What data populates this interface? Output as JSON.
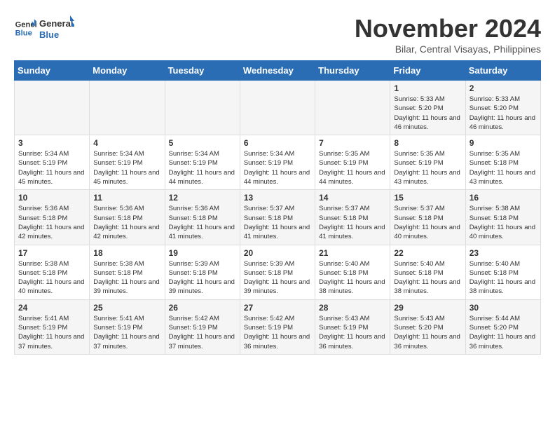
{
  "logo": {
    "line1": "General",
    "line2": "Blue"
  },
  "title": "November 2024",
  "subtitle": "Bilar, Central Visayas, Philippines",
  "weekdays": [
    "Sunday",
    "Monday",
    "Tuesday",
    "Wednesday",
    "Thursday",
    "Friday",
    "Saturday"
  ],
  "weeks": [
    [
      {
        "day": "",
        "info": ""
      },
      {
        "day": "",
        "info": ""
      },
      {
        "day": "",
        "info": ""
      },
      {
        "day": "",
        "info": ""
      },
      {
        "day": "",
        "info": ""
      },
      {
        "day": "1",
        "info": "Sunrise: 5:33 AM\nSunset: 5:20 PM\nDaylight: 11 hours and 46 minutes."
      },
      {
        "day": "2",
        "info": "Sunrise: 5:33 AM\nSunset: 5:20 PM\nDaylight: 11 hours and 46 minutes."
      }
    ],
    [
      {
        "day": "3",
        "info": "Sunrise: 5:34 AM\nSunset: 5:19 PM\nDaylight: 11 hours and 45 minutes."
      },
      {
        "day": "4",
        "info": "Sunrise: 5:34 AM\nSunset: 5:19 PM\nDaylight: 11 hours and 45 minutes."
      },
      {
        "day": "5",
        "info": "Sunrise: 5:34 AM\nSunset: 5:19 PM\nDaylight: 11 hours and 44 minutes."
      },
      {
        "day": "6",
        "info": "Sunrise: 5:34 AM\nSunset: 5:19 PM\nDaylight: 11 hours and 44 minutes."
      },
      {
        "day": "7",
        "info": "Sunrise: 5:35 AM\nSunset: 5:19 PM\nDaylight: 11 hours and 44 minutes."
      },
      {
        "day": "8",
        "info": "Sunrise: 5:35 AM\nSunset: 5:19 PM\nDaylight: 11 hours and 43 minutes."
      },
      {
        "day": "9",
        "info": "Sunrise: 5:35 AM\nSunset: 5:18 PM\nDaylight: 11 hours and 43 minutes."
      }
    ],
    [
      {
        "day": "10",
        "info": "Sunrise: 5:36 AM\nSunset: 5:18 PM\nDaylight: 11 hours and 42 minutes."
      },
      {
        "day": "11",
        "info": "Sunrise: 5:36 AM\nSunset: 5:18 PM\nDaylight: 11 hours and 42 minutes."
      },
      {
        "day": "12",
        "info": "Sunrise: 5:36 AM\nSunset: 5:18 PM\nDaylight: 11 hours and 41 minutes."
      },
      {
        "day": "13",
        "info": "Sunrise: 5:37 AM\nSunset: 5:18 PM\nDaylight: 11 hours and 41 minutes."
      },
      {
        "day": "14",
        "info": "Sunrise: 5:37 AM\nSunset: 5:18 PM\nDaylight: 11 hours and 41 minutes."
      },
      {
        "day": "15",
        "info": "Sunrise: 5:37 AM\nSunset: 5:18 PM\nDaylight: 11 hours and 40 minutes."
      },
      {
        "day": "16",
        "info": "Sunrise: 5:38 AM\nSunset: 5:18 PM\nDaylight: 11 hours and 40 minutes."
      }
    ],
    [
      {
        "day": "17",
        "info": "Sunrise: 5:38 AM\nSunset: 5:18 PM\nDaylight: 11 hours and 40 minutes."
      },
      {
        "day": "18",
        "info": "Sunrise: 5:38 AM\nSunset: 5:18 PM\nDaylight: 11 hours and 39 minutes."
      },
      {
        "day": "19",
        "info": "Sunrise: 5:39 AM\nSunset: 5:18 PM\nDaylight: 11 hours and 39 minutes."
      },
      {
        "day": "20",
        "info": "Sunrise: 5:39 AM\nSunset: 5:18 PM\nDaylight: 11 hours and 39 minutes."
      },
      {
        "day": "21",
        "info": "Sunrise: 5:40 AM\nSunset: 5:18 PM\nDaylight: 11 hours and 38 minutes."
      },
      {
        "day": "22",
        "info": "Sunrise: 5:40 AM\nSunset: 5:18 PM\nDaylight: 11 hours and 38 minutes."
      },
      {
        "day": "23",
        "info": "Sunrise: 5:40 AM\nSunset: 5:18 PM\nDaylight: 11 hours and 38 minutes."
      }
    ],
    [
      {
        "day": "24",
        "info": "Sunrise: 5:41 AM\nSunset: 5:19 PM\nDaylight: 11 hours and 37 minutes."
      },
      {
        "day": "25",
        "info": "Sunrise: 5:41 AM\nSunset: 5:19 PM\nDaylight: 11 hours and 37 minutes."
      },
      {
        "day": "26",
        "info": "Sunrise: 5:42 AM\nSunset: 5:19 PM\nDaylight: 11 hours and 37 minutes."
      },
      {
        "day": "27",
        "info": "Sunrise: 5:42 AM\nSunset: 5:19 PM\nDaylight: 11 hours and 36 minutes."
      },
      {
        "day": "28",
        "info": "Sunrise: 5:43 AM\nSunset: 5:19 PM\nDaylight: 11 hours and 36 minutes."
      },
      {
        "day": "29",
        "info": "Sunrise: 5:43 AM\nSunset: 5:20 PM\nDaylight: 11 hours and 36 minutes."
      },
      {
        "day": "30",
        "info": "Sunrise: 5:44 AM\nSunset: 5:20 PM\nDaylight: 11 hours and 36 minutes."
      }
    ]
  ]
}
